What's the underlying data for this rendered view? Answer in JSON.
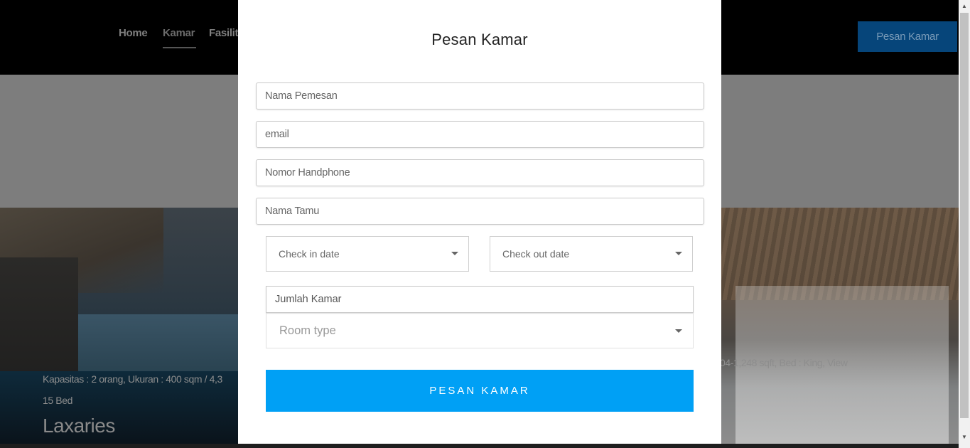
{
  "nav": {
    "items": [
      "Home",
      "Kamar",
      "Fasilit"
    ],
    "active": "Kamar",
    "cta_label": "Pesan Kamar"
  },
  "rooms": {
    "left": {
      "info_line1": "Kapasitas : 2 orang, Ukuran : 400 sqm / 4,3",
      "info_line2": "15 Bed",
      "title": "Laxaries"
    },
    "right": {
      "info_line1": "04-1,248 sqft, Bed : King, View"
    }
  },
  "modal": {
    "title": "Pesan Kamar",
    "fields": {
      "nama_pemesan": "Nama Pemesan",
      "email": "email",
      "nomor_handphone": "Nomor Handphone",
      "nama_tamu": "Nama Tamu",
      "jumlah_kamar": "Jumlah Kamar"
    },
    "checkin_label": "Check in date",
    "checkout_label": "Check out date",
    "room_type_label": "Room type",
    "submit_label": "PESAN KAMAR"
  },
  "colors": {
    "submit_button": "#00a0f5",
    "nav_cta": "#06457a",
    "page_overlay": "#000000"
  },
  "icons": {
    "dropdown": "caret-down-icon",
    "scroll_up": "scroll-up-arrow-icon",
    "scroll_down": "scroll-down-arrow-icon"
  }
}
